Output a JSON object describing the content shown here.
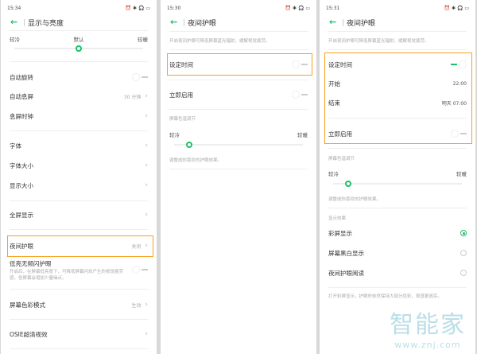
{
  "panel1": {
    "time": "15:34",
    "status_icons": "⏰ ✱ 🎧 ▭",
    "title": "显示与亮度",
    "slider": {
      "left": "较冷",
      "mid": "默认",
      "right": "较暖",
      "value": 0.5
    },
    "auto_rotate": "自动旋转",
    "auto_sleep": "自动息屏",
    "auto_sleep_value": "30 分钟",
    "aod_clock": "息屏时钟",
    "font": "字体",
    "font_size": "字体大小",
    "display_size": "显示大小",
    "fullscreen": "全屏显示",
    "night_mode": "夜间护眼",
    "night_mode_value": "关闭",
    "dc_dimming": "低亮无频闪护眼",
    "dc_desc": "开启后，在屏幕低亮度下，可降低屏幕闪烁产生的视觉疲劳感，但屏幕会增加少量噪点。",
    "color_mode": "屏幕色彩模式",
    "color_mode_value": "生动",
    "osie": "OSIE超清视效"
  },
  "panel2": {
    "time": "15:30",
    "title": "夜间护眼",
    "desc": "开启夜间护眼可降低屏幕蓝光辐射，缓解视觉疲劳。",
    "schedule": "设定时间",
    "enable_now": "立即启用",
    "temp_header": "屏幕色温调节",
    "slider": {
      "left": "较冷",
      "right": "较暖",
      "value": 0.12
    },
    "temp_desc": "调整成你喜欢的护眼效果。"
  },
  "panel3": {
    "time": "15:31",
    "title": "夜间护眼",
    "desc": "开启夜间护眼可降低屏幕蓝光辐射，缓解视觉疲劳。",
    "schedule": "设定时间",
    "start": "开始",
    "start_value": "22:00",
    "end": "结束",
    "end_value": "明天 07:00",
    "enable_now": "立即启用",
    "temp_header": "屏幕色温调节",
    "slider": {
      "left": "较冷",
      "right": "较暖",
      "value": 0.12
    },
    "temp_desc": "调整成你喜欢的护眼效果。",
    "effect_header": "显示效果",
    "options": [
      "彩屏显示",
      "屏幕黑白显示",
      "夜间护眼阅读"
    ],
    "selected": 0,
    "effect_desc": "打开彩屏显示，护眼时依然保持大部分色彩，观感更真实。"
  },
  "watermark": {
    "brand": "智能家",
    "url": "www.znj.com"
  },
  "colors": {
    "accent": "#1bbf6a",
    "highlight": "#f7a020"
  }
}
